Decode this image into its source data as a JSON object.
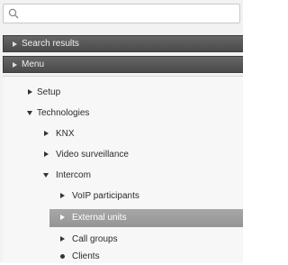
{
  "search": {
    "placeholder": "",
    "value": "",
    "icon": "search-icon"
  },
  "sections": [
    {
      "label": "Search results",
      "icon": "triangle-right-icon"
    },
    {
      "label": "Menu",
      "icon": "triangle-right-icon"
    }
  ],
  "tree": {
    "setup": "Setup",
    "technologies": "Technologies",
    "knx": "KNX",
    "video_surveillance": "Video surveillance",
    "intercom": "Intercom",
    "voip_participants": "VoIP participants",
    "external_units": "External units",
    "call_groups": "Call groups",
    "clients": "Clients"
  },
  "colors": {
    "section_bar": "#555555",
    "selected_row": "#9e9e9e",
    "panel_background": "#f2f2f2"
  }
}
